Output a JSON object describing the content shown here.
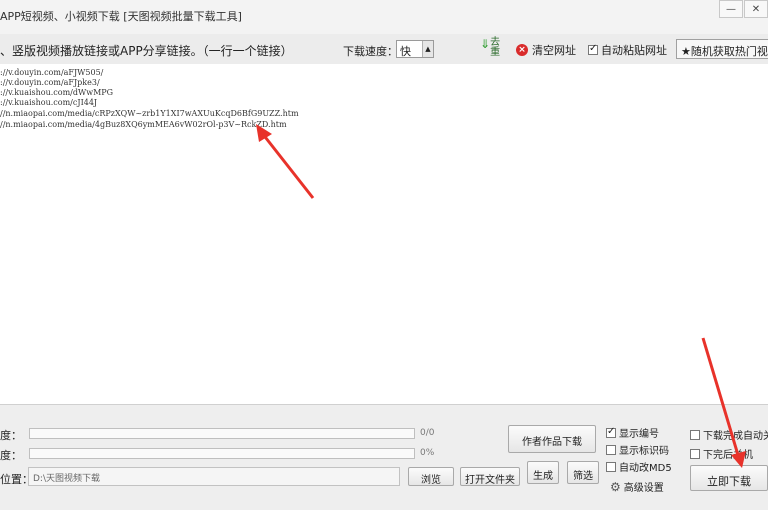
{
  "window": {
    "title": "APP短视频、小视频下载 [天图视频批量下载工具]",
    "buttons": [
      "—",
      "✕"
    ]
  },
  "toolbar": {
    "hint": "、竖版视频播放链接或APP分享链接。（一行一个链接）",
    "speed_label": "下载速度：",
    "speed_value": "快",
    "dedup_label": "去重",
    "clear_label": "清空网址",
    "autopaste_label": "自动粘贴网址",
    "autopaste_checked": true,
    "random_label": "★随机获取热门视频"
  },
  "urls": [
    "://v.douyin.com/aFJW505/",
    "://v.douyin.com/aFJpke3/",
    "://v.kuaishou.com/dWwMPG",
    "://v.kuaishou.com/cJI44J",
    "//n.miaopai.com/media/cRPzXQW~zrb1Y1XI7wAXUuKcqD6BfG9UZZ.htm",
    "//n.miaopai.com/media/4gBuz8XQ6ymMEA6vW02rOl-p3V~RckZD.htm"
  ],
  "bottom": {
    "progress1_label": "度：",
    "progress1_value": 0.0,
    "progress1_text": "0/0",
    "progress2_label": "度：",
    "progress2_value": 0.0,
    "progress2_text": "0%",
    "path_label": "位置：",
    "path_value": "D:\\天图视频下载",
    "browse_label": "浏览",
    "open_folder_label": "打开文件夹",
    "author_works_label": "作者作品下载",
    "generate_label": "生成",
    "filter_label": "筛选",
    "show_number_label": "显示编号",
    "show_number_checked": true,
    "show_id_label": "显示标识码",
    "show_id_checked": false,
    "auto_md5_label": "自动改MD5",
    "auto_md5_checked": false,
    "advanced_label": "高级设置",
    "after_download_label": "下载完成自动关",
    "after_download_checked": false,
    "shutdown_label": "下完后关机",
    "shutdown_checked": false,
    "download_now_label": "立即下载"
  },
  "colors": {
    "arrow": "#e8322a",
    "progress_fill": "#4a9be0",
    "toolbar_bg": "#ececec"
  }
}
